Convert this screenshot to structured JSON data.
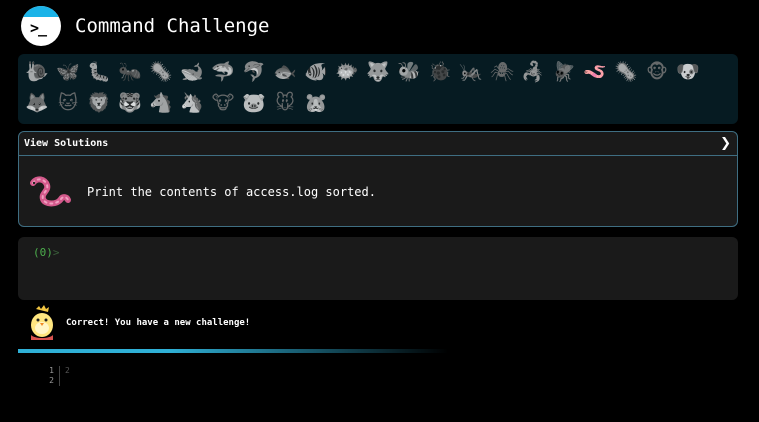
{
  "header": {
    "logo_icon": "terminal-prompt-icon",
    "logo_text": ">_",
    "title": "Command Challenge"
  },
  "emoji_bar": {
    "items": [
      {
        "icon": "snail-icon",
        "glyph": "🐌"
      },
      {
        "icon": "butterfly-icon",
        "glyph": "🦋"
      },
      {
        "icon": "caterpillar-icon",
        "glyph": "🐛"
      },
      {
        "icon": "ant-icon",
        "glyph": "🐜"
      },
      {
        "icon": "virus-icon",
        "glyph": "🦠"
      },
      {
        "icon": "whale-icon",
        "glyph": "🐋"
      },
      {
        "icon": "shark-icon",
        "glyph": "🦈"
      },
      {
        "icon": "dolphin-icon",
        "glyph": "🐬"
      },
      {
        "icon": "fish-icon",
        "glyph": "🐟"
      },
      {
        "icon": "tropical-fish-icon",
        "glyph": "🐠"
      },
      {
        "icon": "blowfish-icon",
        "glyph": "🐡"
      },
      {
        "icon": "wolf-icon",
        "glyph": "🐺"
      },
      {
        "icon": "bee-icon",
        "glyph": "🐝"
      },
      {
        "icon": "ladybug-icon",
        "glyph": "🐞"
      },
      {
        "icon": "cricket-icon",
        "glyph": "🦗"
      },
      {
        "icon": "spider-icon",
        "glyph": "🕷"
      },
      {
        "icon": "scorpion-icon",
        "glyph": "🦂"
      },
      {
        "icon": "fly-icon",
        "glyph": "🪰"
      },
      {
        "icon": "worm-icon",
        "glyph": "🪱",
        "active": true
      },
      {
        "icon": "microbe-icon",
        "glyph": "🦠"
      },
      {
        "icon": "monkey-face-icon",
        "glyph": "🐵"
      },
      {
        "icon": "dog-face-icon",
        "glyph": "🐶"
      },
      {
        "icon": "fox-face-icon",
        "glyph": "🦊"
      },
      {
        "icon": "cat-face-icon",
        "glyph": "🐱"
      },
      {
        "icon": "lion-face-icon",
        "glyph": "🦁"
      },
      {
        "icon": "tiger-face-icon",
        "glyph": "🐯"
      },
      {
        "icon": "horse-face-icon",
        "glyph": "🐴"
      },
      {
        "icon": "unicorn-face-icon",
        "glyph": "🦄"
      },
      {
        "icon": "cow-face-icon",
        "glyph": "🐮"
      },
      {
        "icon": "pig-face-icon",
        "glyph": "🐷"
      },
      {
        "icon": "mouse-face-icon",
        "glyph": "🐭"
      },
      {
        "icon": "hamster-face-icon",
        "glyph": "🐹"
      }
    ]
  },
  "solutions": {
    "toggle_label": "View Solutions",
    "chevron_icon": "chevron-right-icon",
    "challenge_icon": "worm-icon",
    "challenge_text": "Print the contents of access.log sorted."
  },
  "terminal": {
    "prompt": "(0)",
    "arrow": ">"
  },
  "feedback": {
    "avatar_icon": "chick-icon",
    "message": "Correct! You have a new challenge!"
  },
  "progress": {
    "fraction": 0.6
  },
  "editor": {
    "line_numbers": [
      "1",
      "2"
    ],
    "lines": [
      "2",
      ""
    ]
  },
  "colors": {
    "accent": "#2fb0d6",
    "panel": "#1a1a1a",
    "emoji_panel": "#061b22",
    "border": "#3f6e82",
    "prompt_green": "#4cae4c"
  }
}
